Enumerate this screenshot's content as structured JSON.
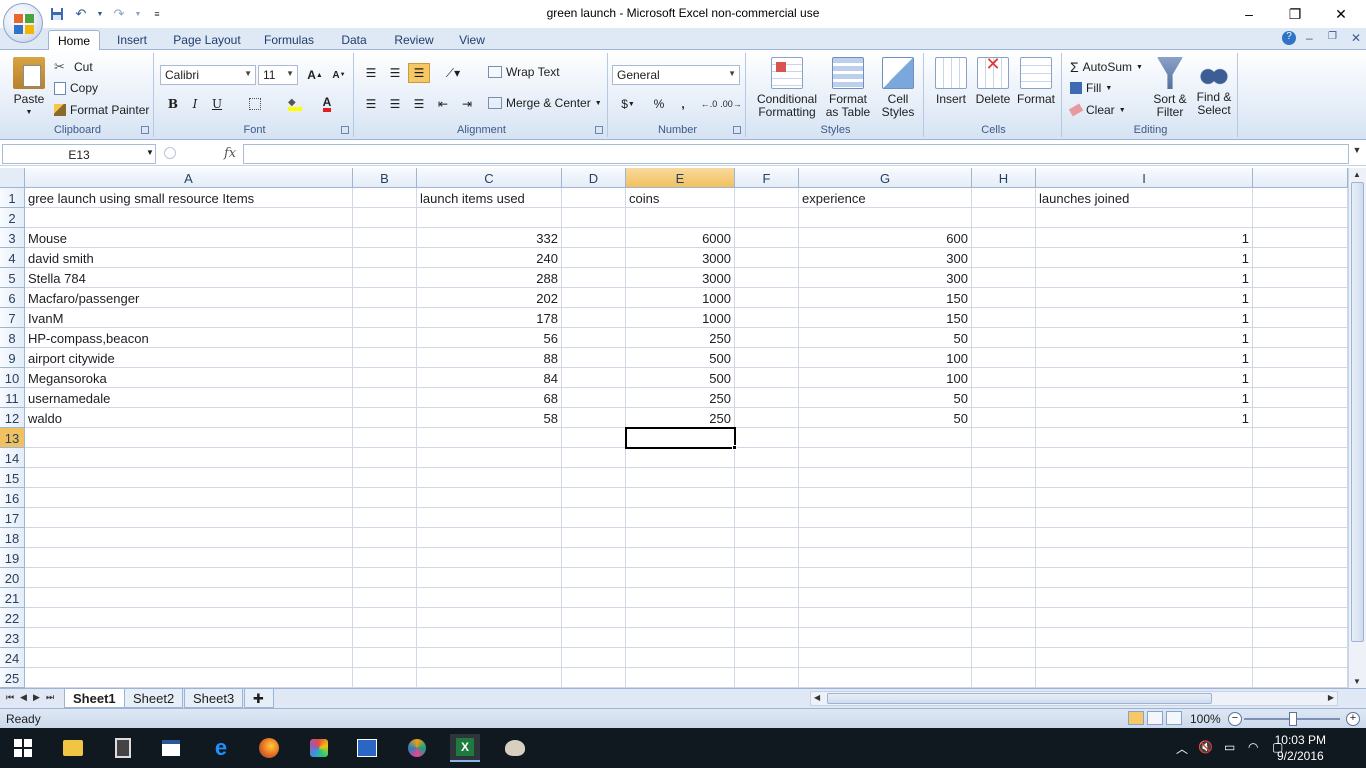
{
  "window": {
    "title": "green launch - Microsoft Excel non-commercial use",
    "minimize": "–",
    "restore": "❐",
    "close": "✕"
  },
  "quick_access": {
    "save_icon": "save-icon",
    "undo_icon": "undo-icon",
    "redo_icon": "redo-icon"
  },
  "tabs": [
    "Home",
    "Insert",
    "Page Layout",
    "Formulas",
    "Data",
    "Review",
    "View"
  ],
  "ribbon": {
    "clipboard": {
      "label": "Clipboard",
      "paste": "Paste",
      "cut": "Cut",
      "copy": "Copy",
      "format_painter": "Format Painter"
    },
    "font": {
      "label": "Font",
      "font_name": "Calibri",
      "font_size": "11",
      "grow": "A",
      "shrink": "A",
      "bold": "B",
      "italic": "I",
      "underline": "U",
      "font_color_letter": "A"
    },
    "alignment": {
      "label": "Alignment",
      "wrap_text": "Wrap Text",
      "merge_center": "Merge & Center"
    },
    "number": {
      "label": "Number",
      "format": "General",
      "currency": "$",
      "percent": "%",
      "comma": ","
    },
    "styles": {
      "label": "Styles",
      "conditional_1": "Conditional",
      "conditional_2": "Formatting",
      "format_table_1": "Format",
      "format_table_2": "as Table",
      "cell_styles_1": "Cell",
      "cell_styles_2": "Styles"
    },
    "cells": {
      "label": "Cells",
      "insert": "Insert",
      "delete": "Delete",
      "format": "Format"
    },
    "editing": {
      "label": "Editing",
      "autosum": "AutoSum",
      "fill": "Fill",
      "clear": "Clear",
      "sort_1": "Sort &",
      "sort_2": "Filter",
      "find_1": "Find &",
      "find_2": "Select"
    }
  },
  "formula_bar": {
    "name_box": "E13",
    "fx": "fx",
    "value": ""
  },
  "columns": [
    "A",
    "B",
    "C",
    "D",
    "E",
    "F",
    "G",
    "H",
    "I"
  ],
  "selected_column": "E",
  "selected_row": 13,
  "rows": [
    {
      "n": "1",
      "A": "gree launch using small resource Items",
      "C": "launch items used",
      "E": "coins",
      "G": "experience",
      "I": "launches joined"
    },
    {
      "n": "2",
      "A": "",
      "C": "",
      "E": "",
      "G": "",
      "I": ""
    },
    {
      "n": "3",
      "A": "Mouse",
      "C": "332",
      "E": "6000",
      "G": "600",
      "I": "1"
    },
    {
      "n": "4",
      "A": "david smith",
      "C": "240",
      "E": "3000",
      "G": "300",
      "I": "1"
    },
    {
      "n": "5",
      "A": "Stella 784",
      "C": "288",
      "E": "3000",
      "G": "300",
      "I": "1"
    },
    {
      "n": "6",
      "A": "Macfaro/passenger",
      "C": "202",
      "E": "1000",
      "G": "150",
      "I": "1"
    },
    {
      "n": "7",
      "A": "IvanM",
      "C": "178",
      "E": "1000",
      "G": "150",
      "I": "1"
    },
    {
      "n": "8",
      "A": "HP-compass,beacon",
      "C": "56",
      "E": "250",
      "G": "50",
      "I": "1"
    },
    {
      "n": "9",
      "A": "airport citywide",
      "C": "88",
      "E": "500",
      "G": "100",
      "I": "1"
    },
    {
      "n": "10",
      "A": "Megansoroka",
      "C": "84",
      "E": "500",
      "G": "100",
      "I": "1"
    },
    {
      "n": "11",
      "A": "usernamedale",
      "C": "68",
      "E": "250",
      "G": "50",
      "I": "1"
    },
    {
      "n": "12",
      "A": "waldo",
      "C": "58",
      "E": "250",
      "G": "50",
      "I": "1"
    },
    {
      "n": "13"
    },
    {
      "n": "14"
    },
    {
      "n": "15"
    },
    {
      "n": "16"
    },
    {
      "n": "17"
    },
    {
      "n": "18"
    },
    {
      "n": "19"
    },
    {
      "n": "20"
    },
    {
      "n": "21"
    },
    {
      "n": "22"
    },
    {
      "n": "23"
    },
    {
      "n": "24"
    },
    {
      "n": "25"
    }
  ],
  "sheets": [
    "Sheet1",
    "Sheet2",
    "Sheet3"
  ],
  "active_sheet": "Sheet1",
  "status": {
    "text": "Ready",
    "zoom": "100%"
  },
  "taskbar": {
    "time": "10:03 PM",
    "date": "9/2/2016"
  }
}
